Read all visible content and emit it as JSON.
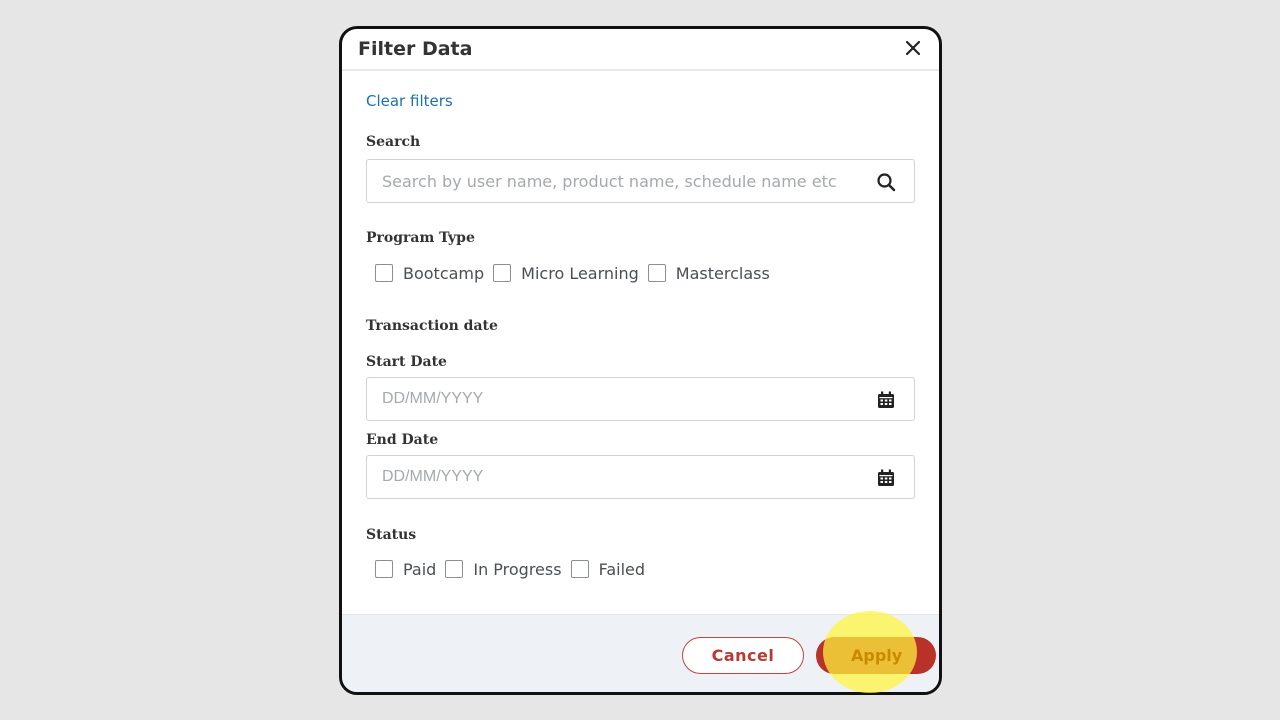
{
  "modal": {
    "title": "Filter Data",
    "clear_filters": "Clear filters"
  },
  "search": {
    "label": "Search",
    "placeholder": "Search by user name, product name, schedule name etc",
    "value": ""
  },
  "program_type": {
    "label": "Program Type",
    "options": [
      {
        "label": "Bootcamp",
        "checked": false
      },
      {
        "label": "Micro Learning",
        "checked": false
      },
      {
        "label": "Masterclass",
        "checked": false
      }
    ]
  },
  "transaction_date": {
    "label": "Transaction date",
    "start_label": "Start Date",
    "start_placeholder": "DD/MM/YYYY",
    "end_label": "End Date",
    "end_placeholder": "DD/MM/YYYY"
  },
  "status": {
    "label": "Status",
    "options": [
      {
        "label": "Paid",
        "checked": false
      },
      {
        "label": "In Progress",
        "checked": false
      },
      {
        "label": "Failed",
        "checked": false
      }
    ]
  },
  "footer": {
    "cancel_label": "Cancel",
    "apply_label": "Apply"
  },
  "icons": {
    "close": "close-icon",
    "search": "search-icon",
    "calendar": "calendar-icon"
  },
  "colors": {
    "link": "#1f6fb0",
    "primary": "#b8322a",
    "highlight": "#fff53c"
  }
}
